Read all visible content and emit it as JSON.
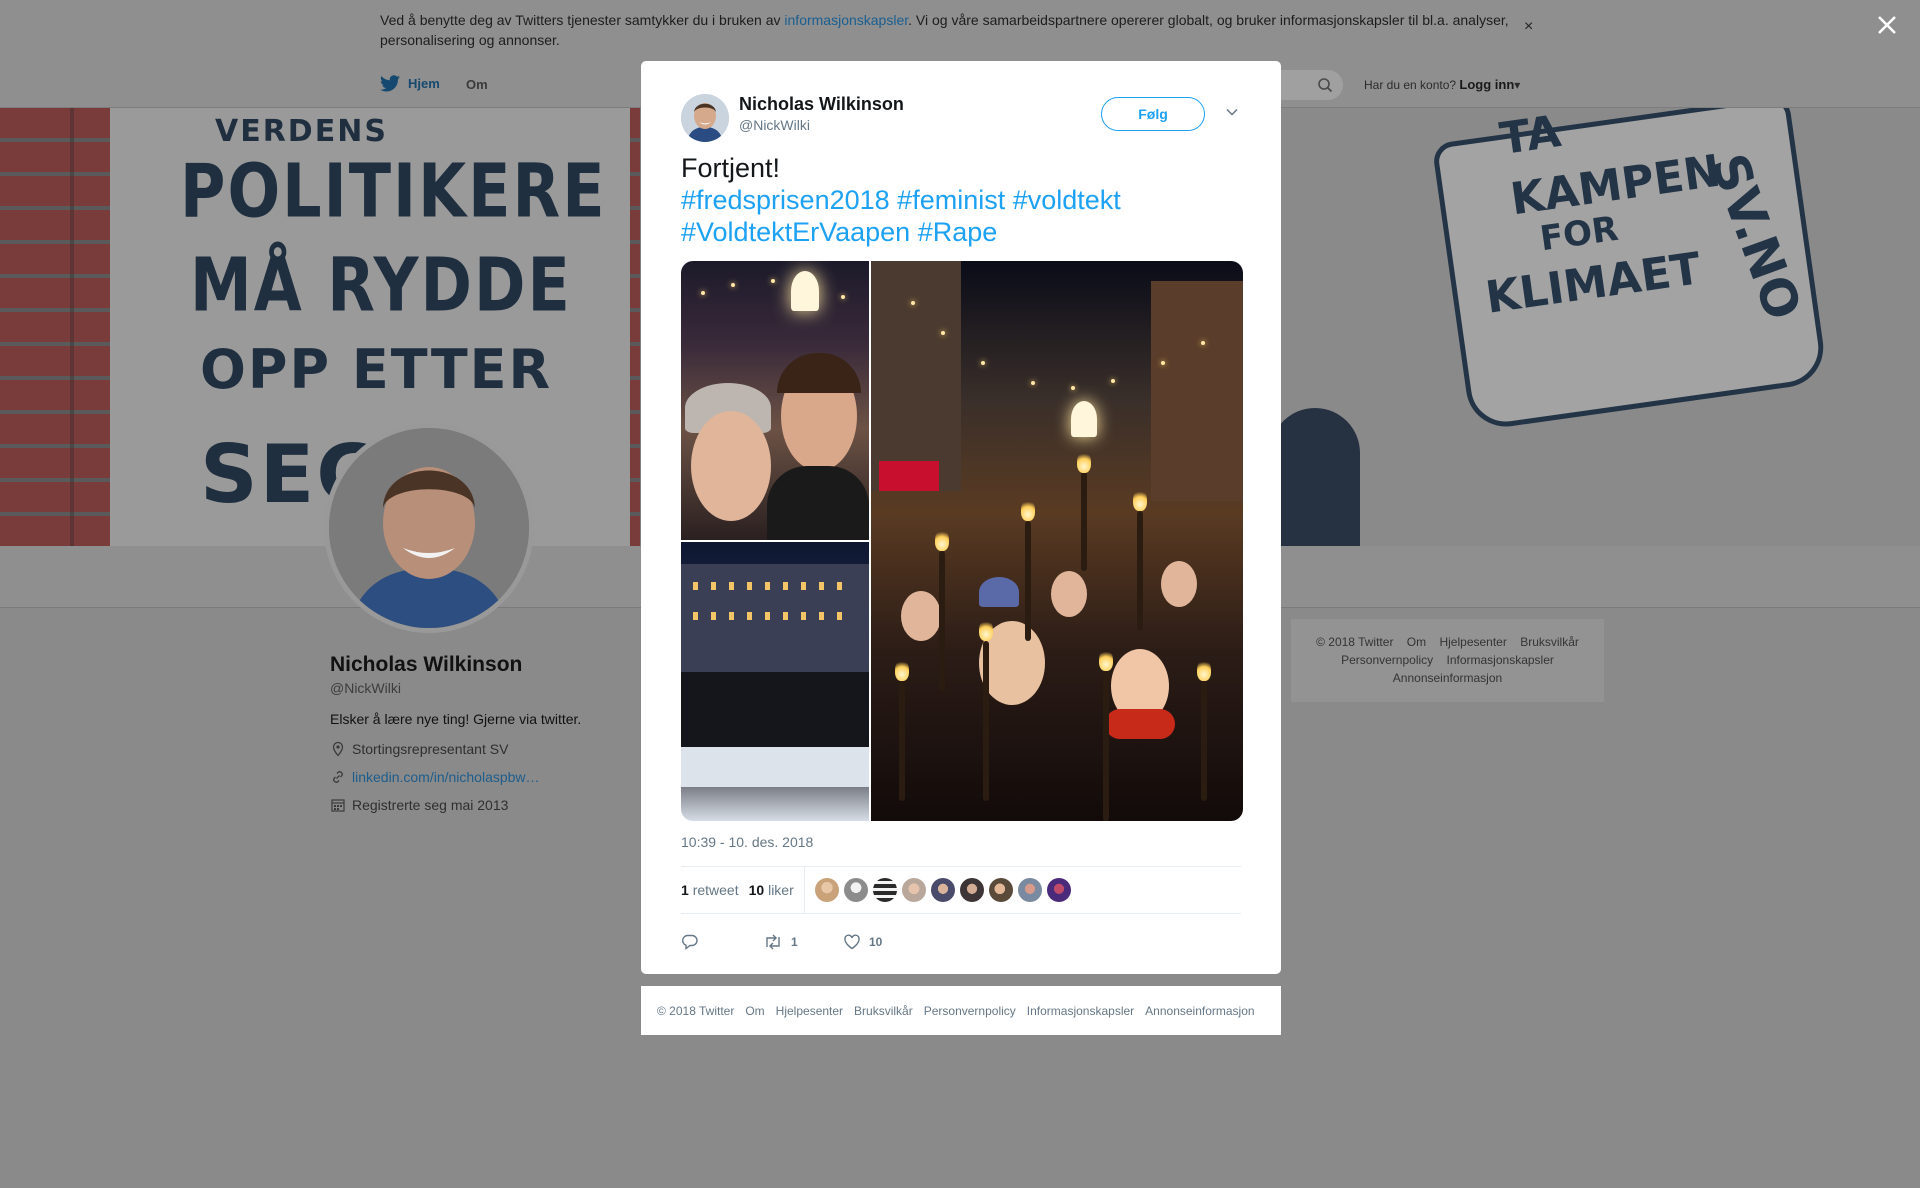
{
  "cookie_banner": {
    "text_before": "Ved å benytte deg av Twitters tjenester samtykker du i bruken av ",
    "link": "informasjonskapsler",
    "text_after": ". Vi og våre samarbeidspartnere opererer globalt, og bruker informasjonskapsler til bl.a. analyser, personalisering og annonser.",
    "close_glyph": "×"
  },
  "nav": {
    "home": "Hjem",
    "about": "Om",
    "account_prompt": "Har du en konto?",
    "login": "Logg inn"
  },
  "banner": {
    "left_words": [
      "VERDENS",
      "POLITIKERE",
      "MÅ RYDDE",
      "OPP ETTER",
      "SEG"
    ],
    "right_words": [
      "TA",
      "KAMPEN",
      "FOR",
      "KLIMAET",
      "SV.NO"
    ]
  },
  "profile": {
    "name": "Nicholas Wilkinson",
    "handle": "@NickWilki",
    "bio": "Elsker å lære nye ting! Gjerne via twitter.",
    "location": "Stortingsrepresentant SV",
    "url": "linkedin.com/in/nicholaspbw…",
    "joined": "Registrerte seg mai 2013"
  },
  "side_footer": {
    "items": [
      "© 2018 Twitter",
      "Om",
      "Hjelpesenter",
      "Bruksvilkår",
      "Personvernpolicy",
      "Informasjonskapsler",
      "Annonseinformasjon"
    ]
  },
  "tweet": {
    "author_name": "Nicholas Wilkinson",
    "author_handle": "@NickWilki",
    "follow_label": "Følg",
    "text": "Fortjent!",
    "hashtags": [
      "#fredsprisen2018",
      "#feminist",
      "#voldtekt",
      "#VoldtektErVaapen",
      "#Rape"
    ],
    "timestamp": "10:39 - 10. des. 2018",
    "retweet_count": "1",
    "retweet_label": "retweet",
    "like_count": "10",
    "like_label": "liker",
    "action_retweets": "1",
    "action_likes": "10",
    "liker_colors": [
      "#c9a27a",
      "#8c8c8c",
      "#2a2a2a",
      "#b8a79a",
      "#4a4a6a",
      "#6a5a5a",
      "#8a6a4a",
      "#a07a7a",
      "#6a3a8a"
    ]
  },
  "modal_footer": {
    "items": [
      "© 2018 Twitter",
      "Om",
      "Hjelpesenter",
      "Bruksvilkår",
      "Personvernpolicy",
      "Informasjonskapsler",
      "Annonseinformasjon"
    ]
  },
  "colors": {
    "twitter_blue": "#1da1f2",
    "text_dark": "#14171a",
    "text_muted": "#657786"
  },
  "icons": [
    "twitter-bird-icon",
    "search-icon",
    "close-icon",
    "chevron-down-icon",
    "location-icon",
    "link-icon",
    "calendar-icon",
    "reply-icon",
    "retweet-icon",
    "heart-icon"
  ]
}
